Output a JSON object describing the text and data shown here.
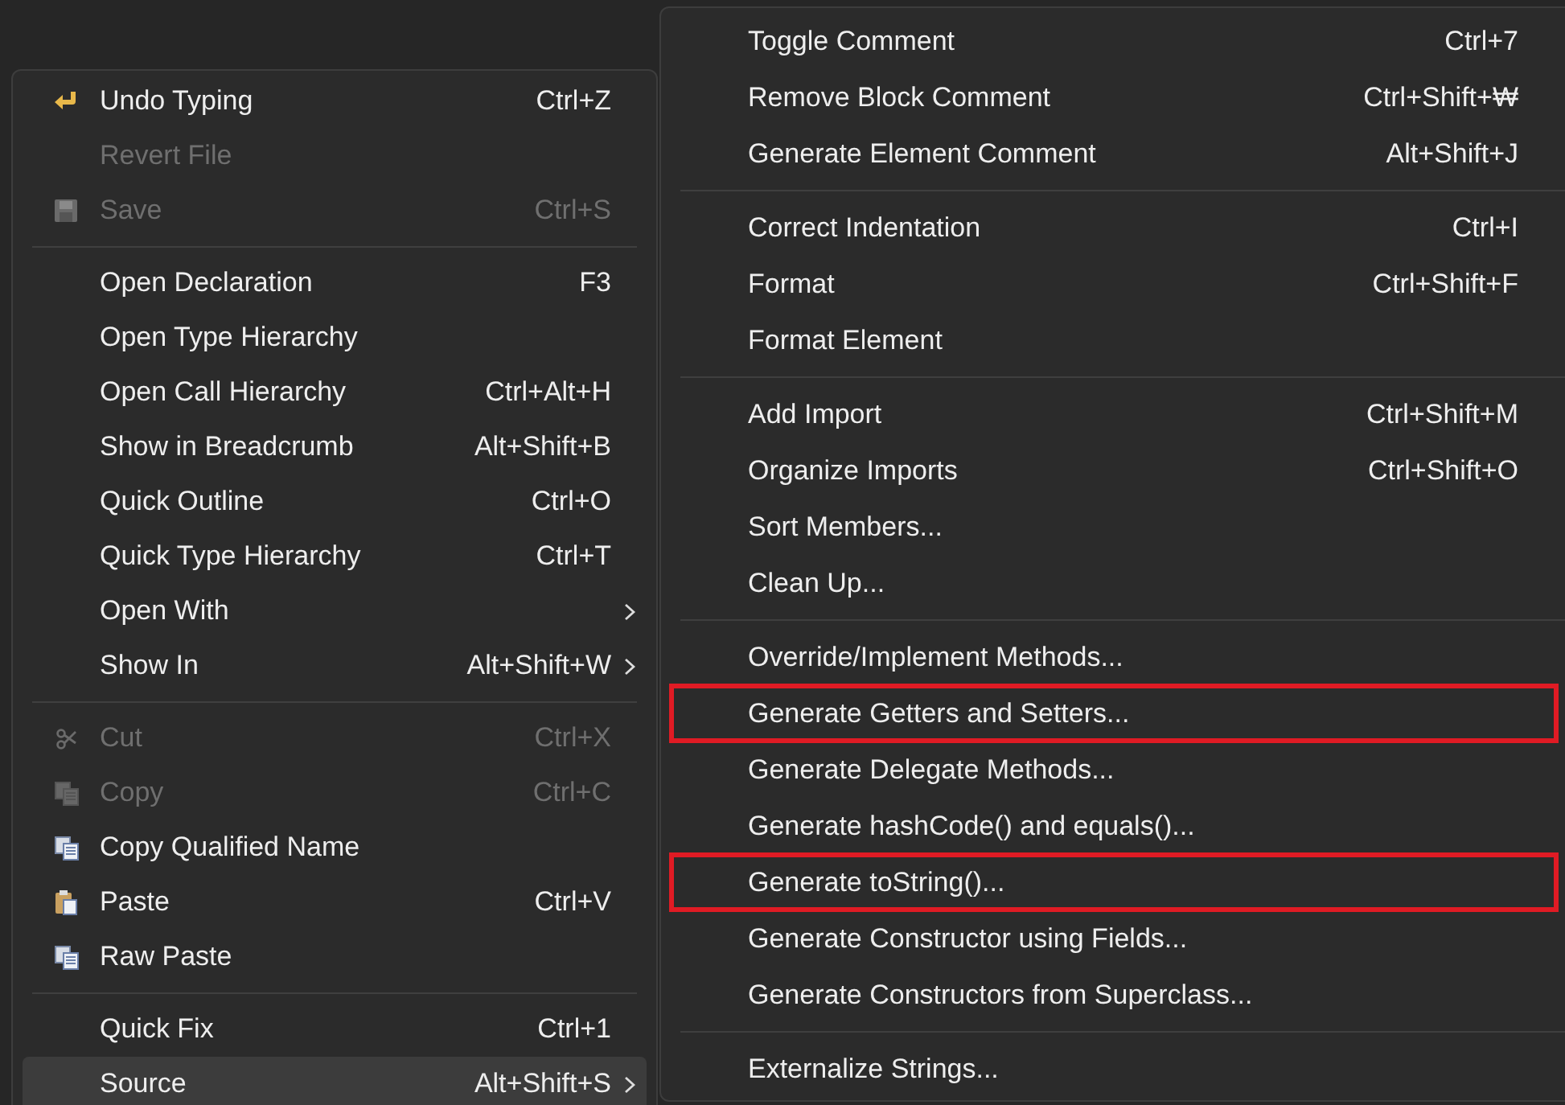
{
  "context_menu": {
    "items": [
      {
        "kind": "undo",
        "label": "Undo Typing",
        "shortcut": "Ctrl+Z",
        "disabled": false
      },
      {
        "kind": "plain",
        "label": "Revert File",
        "disabled": true
      },
      {
        "kind": "save",
        "label": "Save",
        "shortcut": "Ctrl+S",
        "disabled": true
      },
      {
        "kind": "separator"
      },
      {
        "kind": "plain",
        "label": "Open Declaration",
        "shortcut": "F3",
        "disabled": false
      },
      {
        "kind": "plain",
        "label": "Open Type Hierarchy",
        "disabled": false
      },
      {
        "kind": "plain",
        "label": "Open Call Hierarchy",
        "shortcut": "Ctrl+Alt+H",
        "disabled": false
      },
      {
        "kind": "plain",
        "label": "Show in Breadcrumb",
        "shortcut": "Alt+Shift+B",
        "disabled": false
      },
      {
        "kind": "plain",
        "label": "Quick Outline",
        "shortcut": "Ctrl+O",
        "disabled": false
      },
      {
        "kind": "plain",
        "label": "Quick Type Hierarchy",
        "shortcut": "Ctrl+T",
        "disabled": false
      },
      {
        "kind": "plain",
        "label": "Open With",
        "submenu": true,
        "disabled": false
      },
      {
        "kind": "plain",
        "label": "Show In",
        "shortcut": "Alt+Shift+W",
        "submenu": true,
        "disabled": false
      },
      {
        "kind": "separator"
      },
      {
        "kind": "cut",
        "label": "Cut",
        "shortcut": "Ctrl+X",
        "disabled": true
      },
      {
        "kind": "copy",
        "label": "Copy",
        "shortcut": "Ctrl+C",
        "disabled": true
      },
      {
        "kind": "copy",
        "label": "Copy Qualified Name",
        "disabled": false
      },
      {
        "kind": "paste",
        "label": "Paste",
        "shortcut": "Ctrl+V",
        "disabled": false
      },
      {
        "kind": "copy",
        "label": "Raw Paste",
        "disabled": false
      },
      {
        "kind": "separator"
      },
      {
        "kind": "plain",
        "label": "Quick Fix",
        "shortcut": "Ctrl+1",
        "disabled": false
      },
      {
        "kind": "plain",
        "label": "Source",
        "shortcut": "Alt+Shift+S",
        "submenu": true,
        "selected": true,
        "disabled": false
      }
    ]
  },
  "source_submenu": {
    "items": [
      {
        "kind": "item",
        "label": "Toggle Comment",
        "shortcut": "Ctrl+7"
      },
      {
        "kind": "item",
        "label": "Remove Block Comment",
        "shortcut": "Ctrl+Shift+₩"
      },
      {
        "kind": "item",
        "label": "Generate Element Comment",
        "shortcut": "Alt+Shift+J"
      },
      {
        "kind": "separator"
      },
      {
        "kind": "item",
        "label": "Correct Indentation",
        "shortcut": "Ctrl+I"
      },
      {
        "kind": "item",
        "label": "Format",
        "shortcut": "Ctrl+Shift+F"
      },
      {
        "kind": "item",
        "label": "Format Element"
      },
      {
        "kind": "separator"
      },
      {
        "kind": "item",
        "label": "Add Import",
        "shortcut": "Ctrl+Shift+M"
      },
      {
        "kind": "item",
        "label": "Organize Imports",
        "shortcut": "Ctrl+Shift+O"
      },
      {
        "kind": "item",
        "label": "Sort Members..."
      },
      {
        "kind": "item",
        "label": "Clean Up..."
      },
      {
        "kind": "separator"
      },
      {
        "kind": "item",
        "label": "Override/Implement Methods..."
      },
      {
        "kind": "item",
        "label": "Generate Getters and Setters...",
        "annotated": true
      },
      {
        "kind": "item",
        "label": "Generate Delegate Methods..."
      },
      {
        "kind": "item",
        "label": "Generate hashCode() and equals()..."
      },
      {
        "kind": "item",
        "label": "Generate toString()...",
        "annotated": true
      },
      {
        "kind": "item",
        "label": "Generate Constructor using Fields..."
      },
      {
        "kind": "item",
        "label": "Generate Constructors from Superclass..."
      },
      {
        "kind": "separator"
      },
      {
        "kind": "item",
        "label": "Externalize Strings..."
      }
    ]
  }
}
